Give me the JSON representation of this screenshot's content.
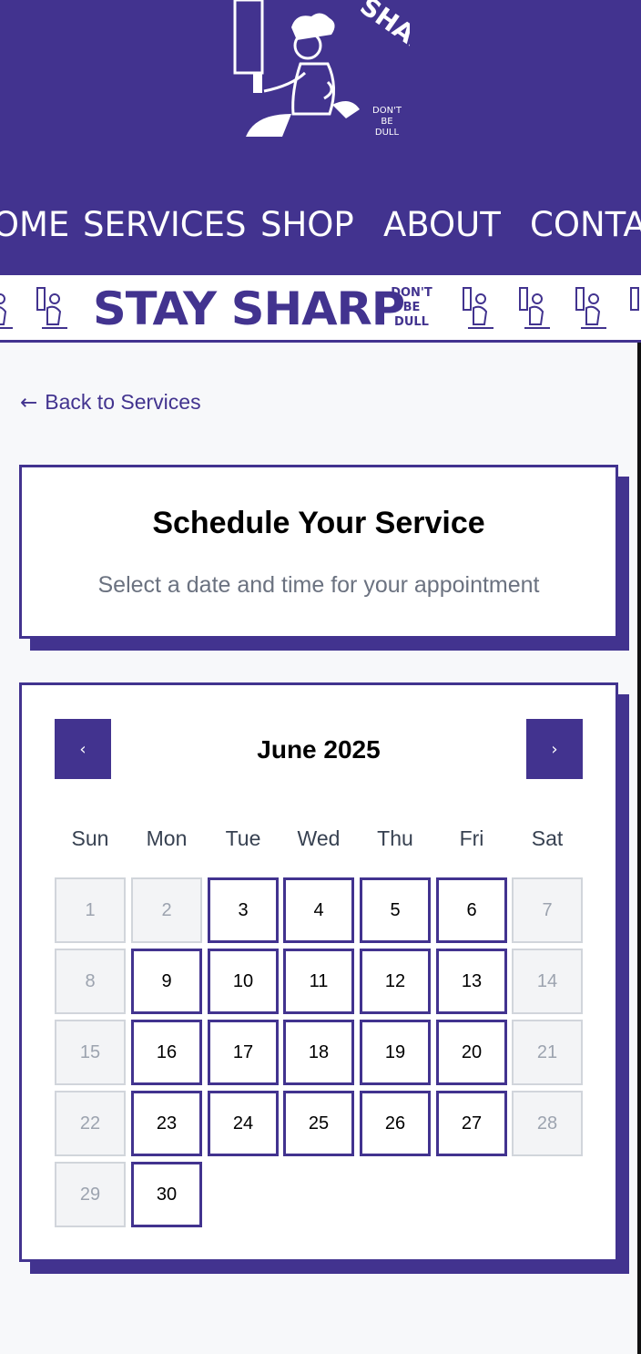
{
  "header": {
    "logo": {
      "wordmark": "STAY SHARP",
      "tagline_lines": [
        "DON'T",
        "BE",
        "DULL"
      ]
    },
    "nav": [
      {
        "label": "HOME"
      },
      {
        "label": "SERVICES"
      },
      {
        "label": "SHOP"
      },
      {
        "label": "ABOUT"
      },
      {
        "label": "CONTACT"
      }
    ]
  },
  "banner": {
    "title": "STAY SHARP",
    "tagline_lines": [
      "DON'T",
      "BE",
      "DULL"
    ]
  },
  "back_link": {
    "arrow": "←",
    "label": "Back to Services"
  },
  "schedule": {
    "title": "Schedule Your Service",
    "subtitle": "Select a date and time for your appointment"
  },
  "calendar": {
    "month_label": "June 2025",
    "prev_label": "‹",
    "next_label": "›",
    "weekdays": [
      "Sun",
      "Mon",
      "Tue",
      "Wed",
      "Thu",
      "Fri",
      "Sat"
    ],
    "days": [
      {
        "label": "1",
        "available": false
      },
      {
        "label": "2",
        "available": false
      },
      {
        "label": "3",
        "available": true
      },
      {
        "label": "4",
        "available": true
      },
      {
        "label": "5",
        "available": true
      },
      {
        "label": "6",
        "available": true
      },
      {
        "label": "7",
        "available": false
      },
      {
        "label": "8",
        "available": false
      },
      {
        "label": "9",
        "available": true
      },
      {
        "label": "10",
        "available": true
      },
      {
        "label": "11",
        "available": true
      },
      {
        "label": "12",
        "available": true
      },
      {
        "label": "13",
        "available": true
      },
      {
        "label": "14",
        "available": false
      },
      {
        "label": "15",
        "available": false
      },
      {
        "label": "16",
        "available": true
      },
      {
        "label": "17",
        "available": true
      },
      {
        "label": "18",
        "available": true
      },
      {
        "label": "19",
        "available": true
      },
      {
        "label": "20",
        "available": true
      },
      {
        "label": "21",
        "available": false
      },
      {
        "label": "22",
        "available": false
      },
      {
        "label": "23",
        "available": true
      },
      {
        "label": "24",
        "available": true
      },
      {
        "label": "25",
        "available": true
      },
      {
        "label": "26",
        "available": true
      },
      {
        "label": "27",
        "available": true
      },
      {
        "label": "28",
        "available": false
      },
      {
        "label": "29",
        "available": false
      },
      {
        "label": "30",
        "available": true
      }
    ]
  },
  "colors": {
    "brand": "#42338f",
    "page_background": "#f7f8fa",
    "unavailable_day_background": "#f3f4f6",
    "unavailable_day_text": "#9ca3af"
  }
}
